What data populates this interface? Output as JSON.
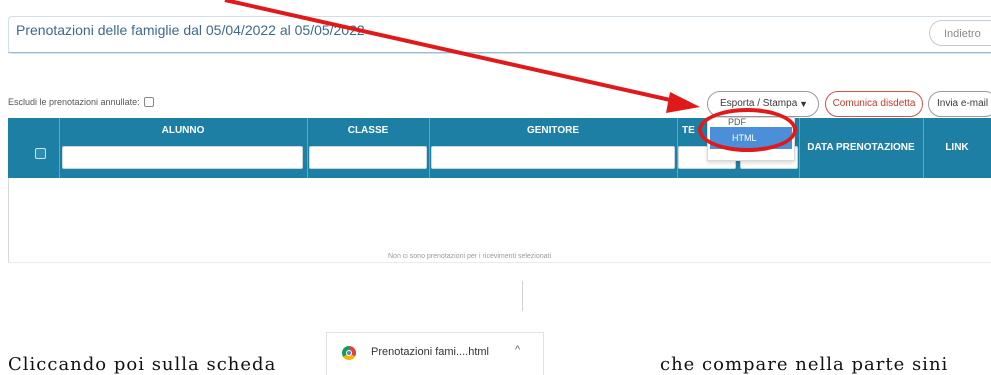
{
  "header": {
    "title": "Prenotazioni delle famiglie dal 05/04/2022 al 05/05/2022",
    "back_label": "Indietro"
  },
  "toolbar": {
    "export_label": "Esporta / Stampa",
    "export_caret": "▼",
    "cancel_label": "Comunica disdetta",
    "mail_label": "Invia e-mail"
  },
  "filter": {
    "exclude_label": "Escludi le prenotazioni annullate:"
  },
  "table": {
    "columns": {
      "alunno": "ALUNNO",
      "classe": "CLASSE",
      "genitore": "GENITORE",
      "telefono": "TE",
      "data": "DATA PRENOTAZIONE",
      "link": "LINK"
    },
    "empty_message": "Non ci sono prenotazioni per i ricevimenti selezionati"
  },
  "export_menu": {
    "items": [
      "PDF",
      "HTML"
    ],
    "selected": "HTML"
  },
  "download_bar": {
    "file_label": "Prenotazioni fami....html",
    "chevron": "^"
  },
  "document": {
    "text_left": "Cliccando poi sulla scheda",
    "text_right": "che compare nella parte sini"
  },
  "annotation": {
    "color": "#e01a1a"
  }
}
